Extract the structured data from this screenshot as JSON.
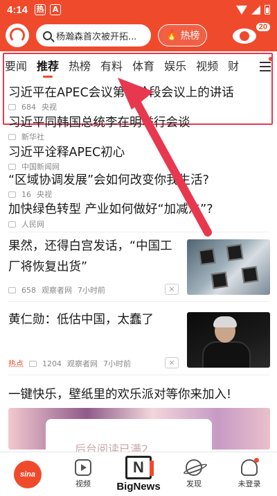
{
  "status_bar": {
    "time": "4:14",
    "badge1": "热",
    "badge2": "A"
  },
  "top_bar": {
    "search_placeholder": "杨瀚森首次被开拓...",
    "hot_label": "热榜",
    "eye_count": "20"
  },
  "tabs": [
    "要闻",
    "推荐",
    "热榜",
    "有料",
    "体育",
    "娱乐",
    "视频",
    "财"
  ],
  "active_tab": "推荐",
  "headlines": [
    {
      "title": "习近平在APEC会议第二阶段会议上的讲话",
      "comments": "684",
      "source": "央视"
    },
    {
      "title": "习近平同韩国总统李在明举行会谈",
      "comments": "",
      "source": "新华社"
    },
    {
      "title": "习近平诠释APEC初心",
      "comments": "",
      "source": "中国新闻网"
    },
    {
      "title": "“区域协调发展”会如何改变你我生活?",
      "comments": "16",
      "source": "央视"
    },
    {
      "title": "加快绿色转型 产业如何做好“加减法”?",
      "comments": "",
      "source": "人民网"
    }
  ],
  "stories": [
    {
      "title": "果然，还得白宫发话，“中国工厂将恢复出货”",
      "comments": "658",
      "source": "观察者网",
      "time": "7小时前"
    },
    {
      "title": "黄仁勋：低估中国，太蠢了",
      "tag": "热点",
      "comments": "1204",
      "source": "观察者网",
      "time": "7小时前"
    },
    {
      "title": "一键快乐，壁纸里的欢乐派对等你来加入!"
    }
  ],
  "ad_text": "后台阅读已满2",
  "close_label": "×",
  "bottom_nav": {
    "home": "sina",
    "video": "视频",
    "bignews_logo": "N",
    "bignews": "BigNews",
    "discover": "发现",
    "login": "未登录"
  },
  "colors": {
    "brand": "#f04a2c",
    "highlight": "#e8384f"
  }
}
